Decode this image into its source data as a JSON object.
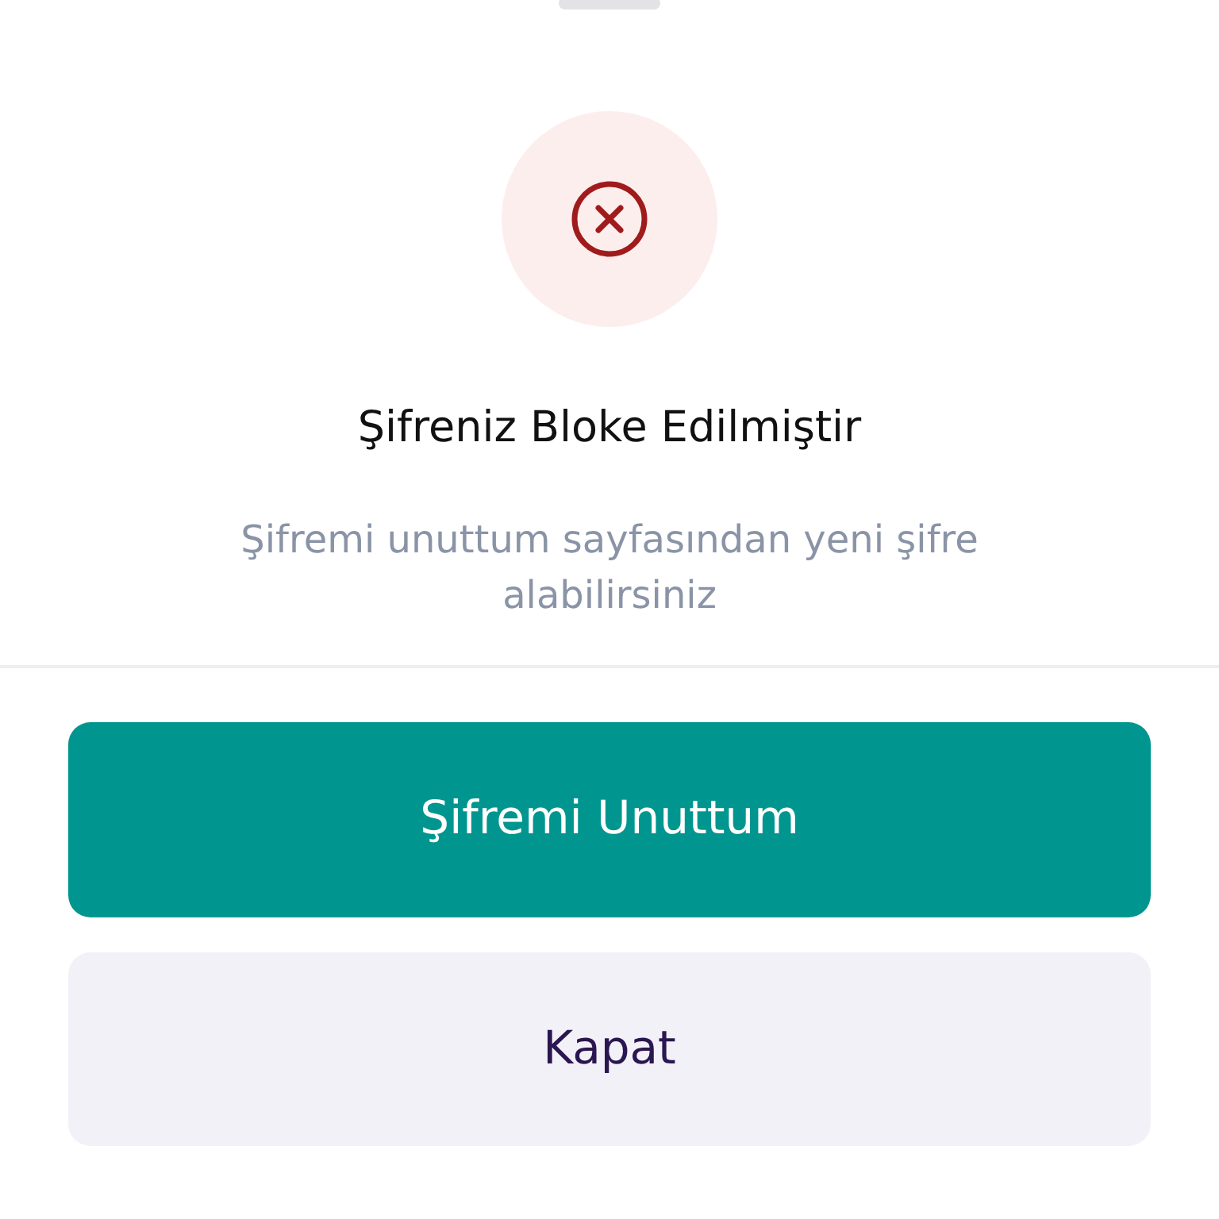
{
  "icon": {
    "kind": "error"
  },
  "title": "Şifreniz Bloke Edilmiştir",
  "message": "Şifremi unuttum sayfasından yeni şifre alabilirsiniz",
  "buttons": [
    {
      "label": "Şifremi Unuttum",
      "kind": "primary"
    },
    {
      "label": "Kapat",
      "kind": "secondary"
    }
  ]
}
